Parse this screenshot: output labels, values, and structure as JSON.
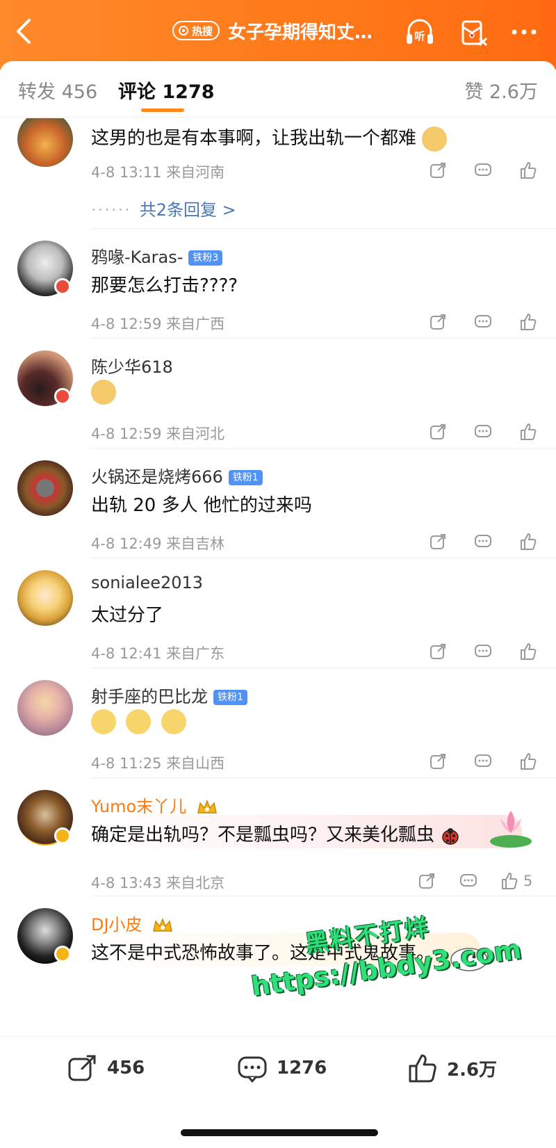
{
  "header": {
    "hot_tag": "热搜",
    "title": "女子孕期得知丈…",
    "listen_label": "听"
  },
  "tabs": {
    "repost": "转发 456",
    "comment": "评论 1278",
    "like": "赞 2.6万"
  },
  "comments": [
    {
      "username": "",
      "content": "这男的也是有本事啊，让我出轨一个都难",
      "meta": "4-8 13:11 来自河南",
      "reply_link": "共2条回复 >"
    },
    {
      "username": "鸦喙-Karas-",
      "fan_badge": "铁粉3",
      "content": "那要怎么打击????",
      "meta": "4-8 12:59 来自广西"
    },
    {
      "username": "陈少华618",
      "content": "",
      "meta": "4-8 12:59 来自河北"
    },
    {
      "username": "火锅还是烧烤666",
      "fan_badge": "铁粉1",
      "content": "出轨 20 多人 他忙的过来吗",
      "meta": "4-8 12:49 来自吉林"
    },
    {
      "username": "sonialee2013",
      "content": "太过分了",
      "meta": "4-8 12:41 来自广东"
    },
    {
      "username": "射手座的巴比龙",
      "fan_badge": "铁粉1",
      "content": "",
      "meta": "4-8 11:25 来自山西"
    },
    {
      "username": "Yumo末丫儿",
      "content": "确定是出轨吗？不是瓢虫吗？又来美化瓢虫",
      "meta": "4-8 13:43 来自北京",
      "like_count": "5"
    },
    {
      "username": "DJ小皮",
      "content": "这不是中式恐怖故事了。这是中式鬼故事。"
    }
  ],
  "watermark": {
    "line1": "黑料不打烊",
    "line2": "https://bbdy3.com"
  },
  "bottom_bar": {
    "repost": "456",
    "comment": "1276",
    "like": "2.6万"
  },
  "colors": {
    "brand_orange": "#ff7a1a",
    "link_blue": "#4a77b8",
    "fan_badge_blue": "#4f93f7"
  }
}
